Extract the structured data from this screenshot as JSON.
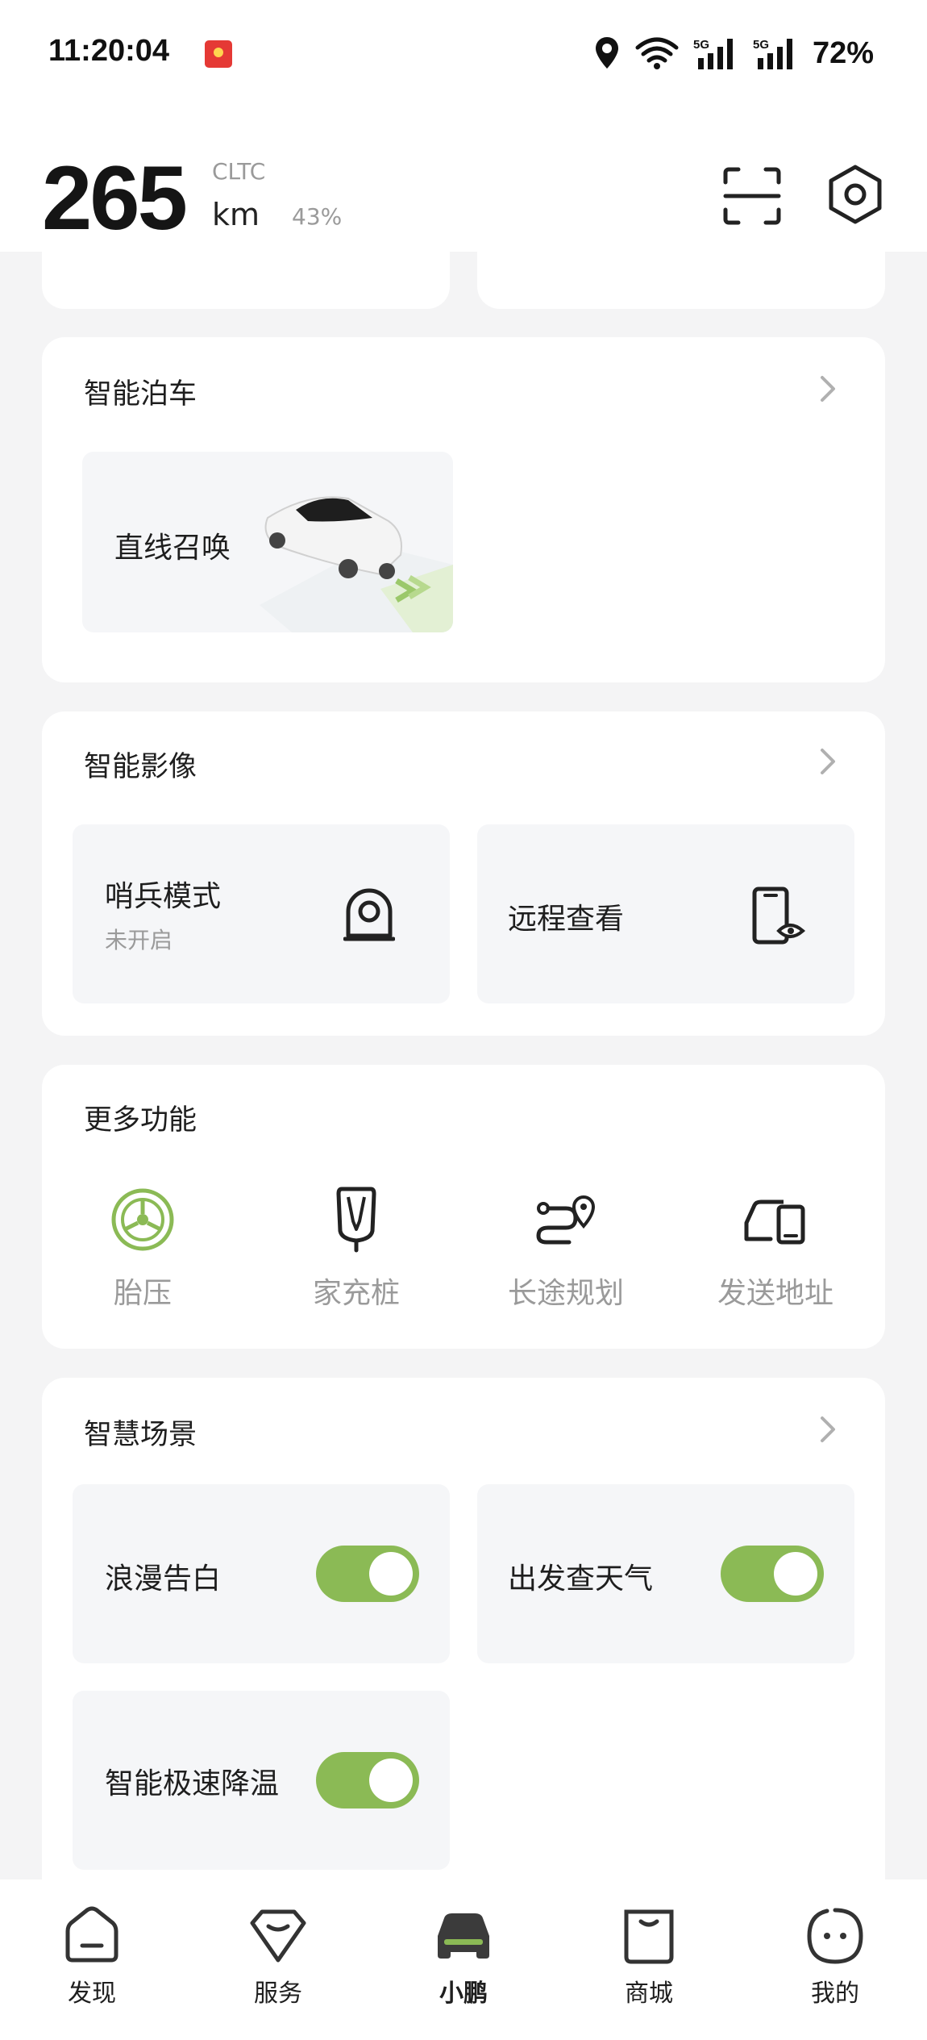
{
  "status_bar": {
    "time": "11:20:04",
    "network_1": "5G",
    "network_2": "5G",
    "battery": "72%"
  },
  "header": {
    "range_value": "265",
    "range_standard": "CLTC",
    "range_unit": "km",
    "battery_percent": "43%",
    "scan_icon": "scan-icon",
    "settings_icon": "settings-hexagon-icon"
  },
  "smart_parking": {
    "title": "智能泊车",
    "tile_label": "直线召唤"
  },
  "smart_video": {
    "title": "智能影像",
    "sentry_label": "哨兵模式",
    "sentry_status": "未开启",
    "remote_label": "远程查看"
  },
  "more_features": {
    "title": "更多功能",
    "items": [
      {
        "label": "胎压",
        "icon": "tire-pressure-icon"
      },
      {
        "label": "家充桩",
        "icon": "home-charger-icon"
      },
      {
        "label": "长途规划",
        "icon": "route-planning-icon"
      },
      {
        "label": "发送地址",
        "icon": "send-address-icon"
      }
    ]
  },
  "smart_scenes": {
    "title": "智慧场景",
    "items": [
      {
        "label": "浪漫告白",
        "enabled": true
      },
      {
        "label": "出发查天气",
        "enabled": true
      },
      {
        "label": "智能极速降温",
        "enabled": true
      }
    ]
  },
  "bottom_nav": {
    "items": [
      {
        "label": "发现",
        "active": false
      },
      {
        "label": "服务",
        "active": false
      },
      {
        "label": "小鹏",
        "active": true
      },
      {
        "label": "商城",
        "active": false
      },
      {
        "label": "我的",
        "active": false
      }
    ]
  },
  "colors": {
    "accent_green": "#8bba55",
    "page_background": "#f4f4f5",
    "card_background": "#ffffff",
    "tile_background": "#f5f6f8"
  }
}
